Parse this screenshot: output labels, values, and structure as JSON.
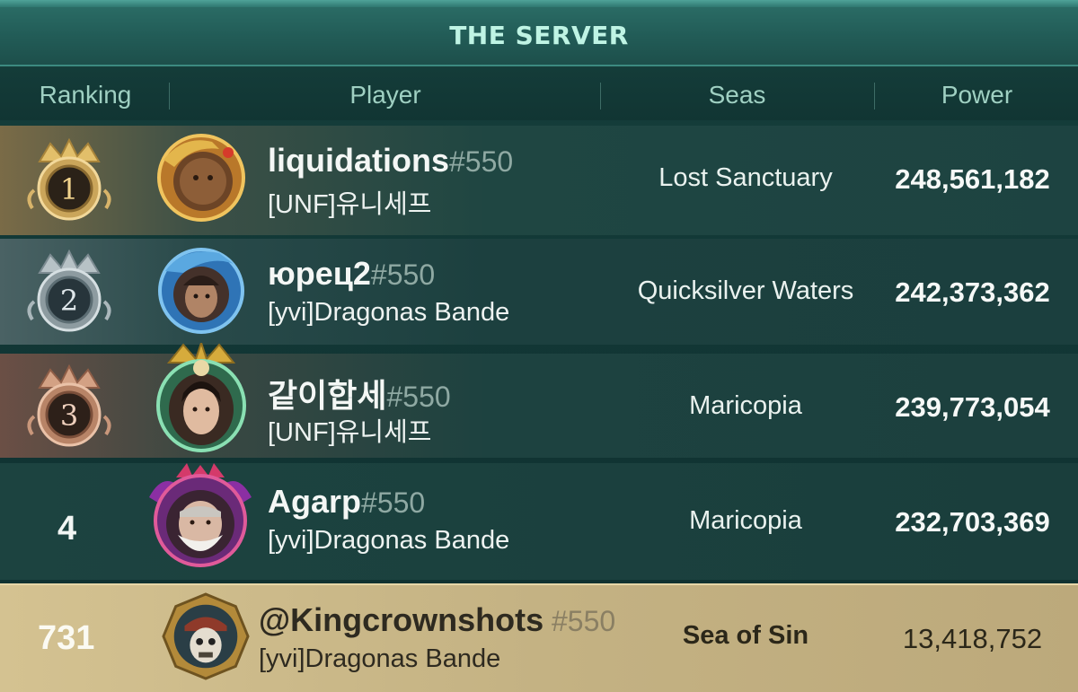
{
  "header": {
    "title": "THE SERVER"
  },
  "columns": {
    "ranking": "Ranking",
    "player": "Player",
    "seas": "Seas",
    "power": "Power"
  },
  "rows": [
    {
      "rank": "1",
      "name": "liquidations",
      "tag": "#550",
      "guild": "[UNF]유니세프",
      "seas": "Lost Sanctuary",
      "power": "248,561,182"
    },
    {
      "rank": "2",
      "name": "юрец2",
      "tag": "#550",
      "guild": "[yvi]Dragonas Bande",
      "seas": "Quicksilver Waters",
      "power": "242,373,362"
    },
    {
      "rank": "3",
      "name": "같이합세",
      "tag": "#550",
      "guild": "[UNF]유니세프",
      "seas": "Maricopia",
      "power": "239,773,054"
    },
    {
      "rank": "4",
      "name": "Agarp",
      "tag": "#550",
      "guild": "[yvi]Dragonas Bande",
      "seas": "Maricopia",
      "power": "232,703,369"
    }
  ],
  "self": {
    "rank": "731",
    "name": "@Kingcrownshots",
    "tag": " #550",
    "guild": "[yvi]Dragonas Bande",
    "seas": "Sea of Sin",
    "power": "13,418,752"
  },
  "colors": {
    "gold": "#d9b25a",
    "silver": "#9fb0b5",
    "bronze": "#c08a6e",
    "teal": "#1d4341",
    "self_highlight": "#c9b787"
  }
}
